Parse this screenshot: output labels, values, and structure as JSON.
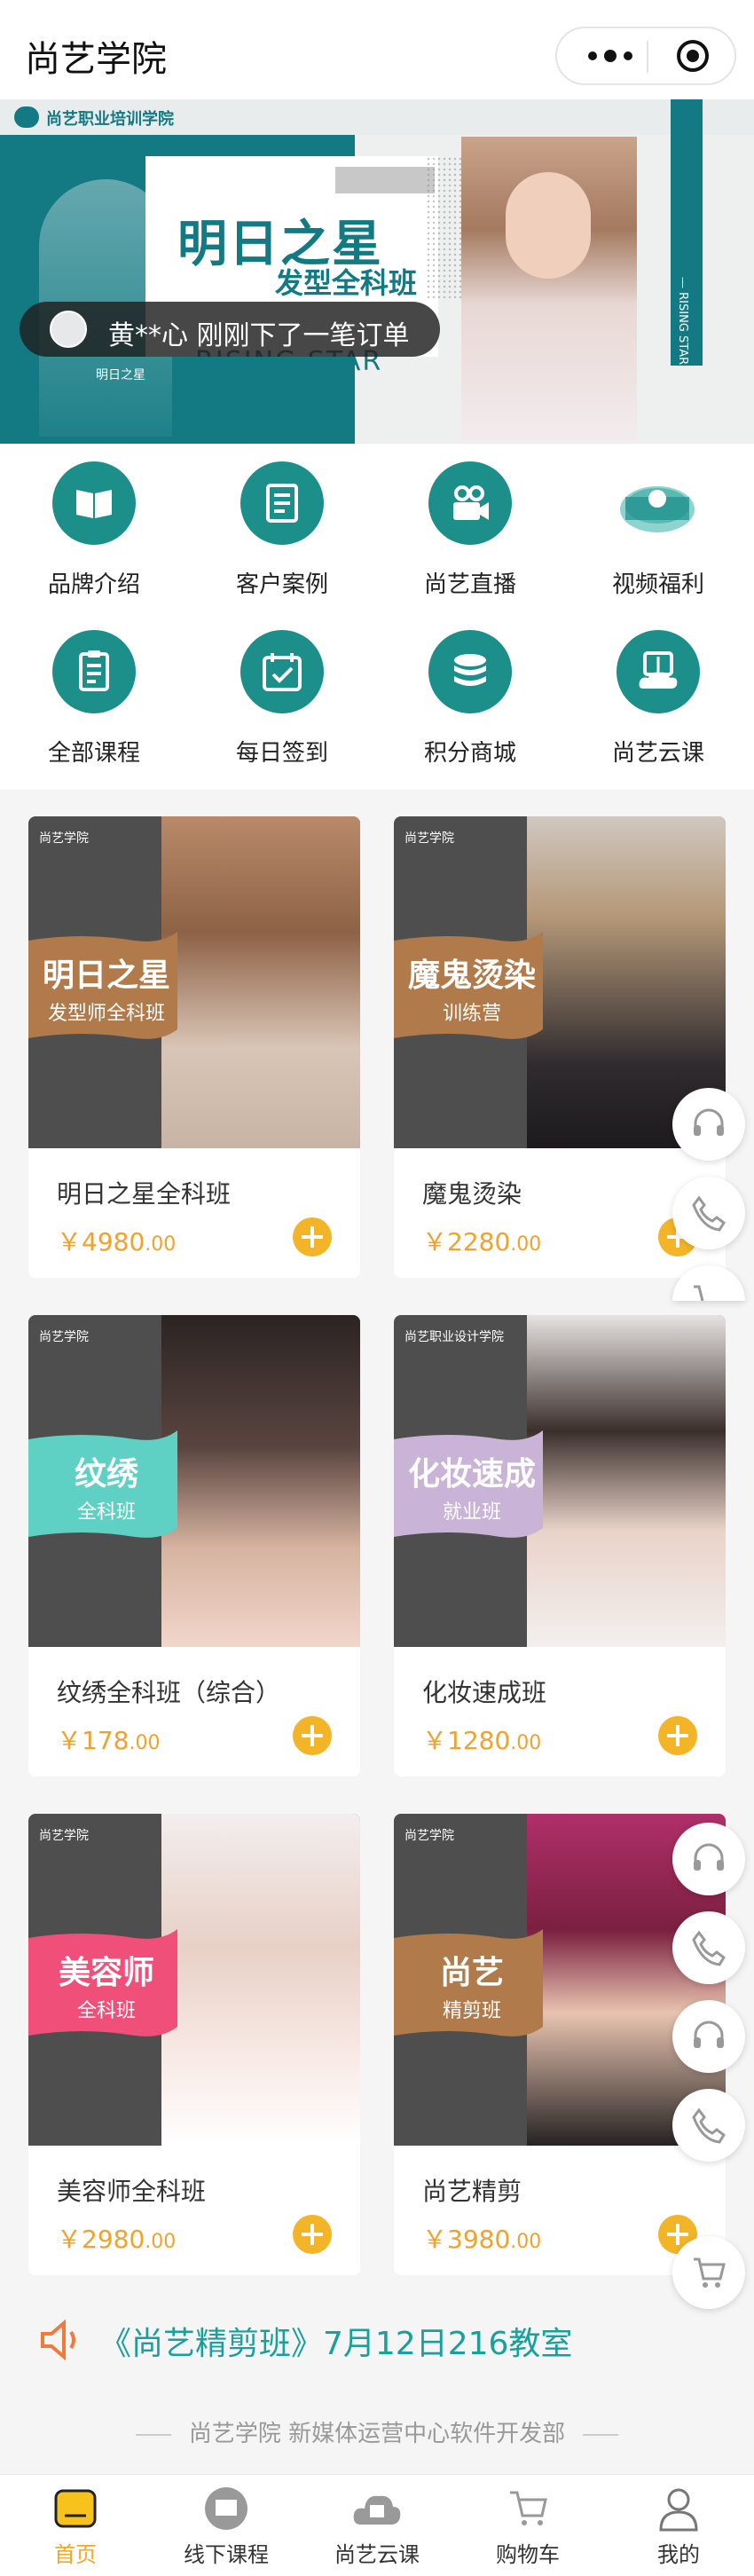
{
  "header": {
    "title": "尚艺学院"
  },
  "banner": {
    "logo_text": "尚艺职业培训学院",
    "title": "明日之星",
    "subtitle": "发型全科班",
    "english": "RISING STAR",
    "vertical_text": "— RISING STAR",
    "small_tag": "明日之星",
    "toast": "黄**心 刚刚下了一笔订单",
    "pages": 3,
    "current_page": 1
  },
  "menu": [
    {
      "label": "品牌介绍",
      "icon": "book-icon"
    },
    {
      "label": "客户案例",
      "icon": "document-icon"
    },
    {
      "label": "尚艺直播",
      "icon": "video-camera-icon"
    },
    {
      "label": "视频福利",
      "icon": "film-roll-icon"
    },
    {
      "label": "全部课程",
      "icon": "course-list-icon"
    },
    {
      "label": "每日签到",
      "icon": "calendar-check-icon"
    },
    {
      "label": "积分商城",
      "icon": "coin-stack-icon"
    },
    {
      "label": "尚艺云课",
      "icon": "cloud-book-icon"
    }
  ],
  "products": [
    {
      "name": "明日之星全科班",
      "price": "4980",
      "cents": ".00",
      "ribbon_title": "明日之星",
      "ribbon_sub": "发型师全科班",
      "brand": "尚艺学院",
      "ribbon_color": "#b07a4a"
    },
    {
      "name": "魔鬼烫染",
      "price": "2280",
      "cents": ".00",
      "ribbon_title": "魔鬼烫染",
      "ribbon_sub": "训练营",
      "brand": "尚艺学院",
      "ribbon_color": "#b07a4a"
    },
    {
      "name": "纹绣全科班（综合）",
      "price": "178",
      "cents": ".00",
      "ribbon_title": "纹绣",
      "ribbon_sub": "全科班",
      "brand": "尚艺学院",
      "ribbon_color": "#5fd1c4"
    },
    {
      "name": "化妆速成班",
      "price": "1280",
      "cents": ".00",
      "ribbon_title": "化妆速成",
      "ribbon_sub": "就业班",
      "brand": "尚艺职业设计学院",
      "ribbon_color": "#c9b3d6"
    },
    {
      "name": "美容师全科班",
      "price": "2980",
      "cents": ".00",
      "ribbon_title": "美容师",
      "ribbon_sub": "全科班",
      "brand": "尚艺学院",
      "ribbon_color": "#f04f7a"
    },
    {
      "name": "尚艺精剪",
      "price": "3980",
      "cents": ".00",
      "ribbon_title": "尚艺",
      "ribbon_sub": "精剪班",
      "brand": "尚艺学院",
      "ribbon_color": "#b07a4a"
    }
  ],
  "currency": "￥",
  "notice": "《尚艺精剪班》7月12日216教室",
  "footer": "尚艺学院 新媒体运营中心软件开发部",
  "tabbar": [
    {
      "label": "首页",
      "icon": "home-icon",
      "active": true
    },
    {
      "label": "线下课程",
      "icon": "classroom-icon",
      "active": false
    },
    {
      "label": "尚艺云课",
      "icon": "cloud-class-icon",
      "active": false
    },
    {
      "label": "购物车",
      "icon": "cart-icon",
      "active": false
    },
    {
      "label": "我的",
      "icon": "user-icon",
      "active": false
    }
  ],
  "colors": {
    "teal": "#137a83",
    "icon_green": "#1c8f8a",
    "price": "#f0a22c",
    "active_tab": "#f3a828"
  }
}
